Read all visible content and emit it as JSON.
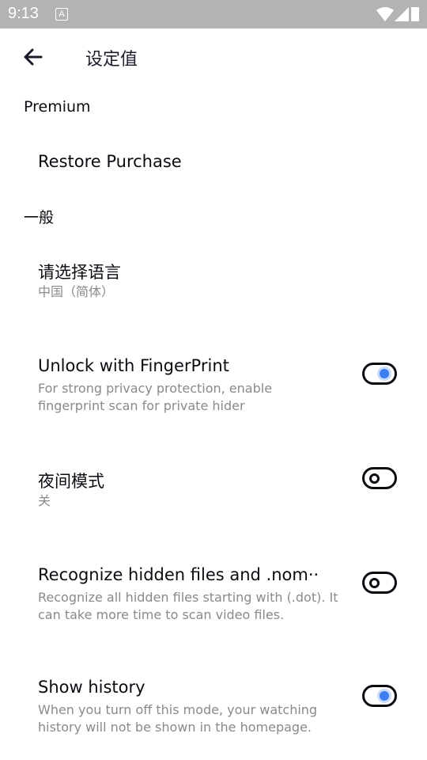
{
  "status_bar": {
    "time": "9:13",
    "notification_label": "A"
  },
  "toolbar": {
    "title": "设定值"
  },
  "sections": {
    "premium": {
      "header": "Premium",
      "restore_label": "Restore Purchase"
    },
    "general": {
      "header": "一般"
    }
  },
  "items": {
    "language": {
      "title": "请选择语言",
      "subtitle": "中国（简体）"
    },
    "fingerprint": {
      "title": "Unlock with FingerPrint",
      "subtitle": "For strong privacy protection, enable fingerprint scan for private hider",
      "enabled": true
    },
    "night_mode": {
      "title": "夜间模式",
      "subtitle": "关",
      "enabled": false
    },
    "hidden_files": {
      "title": "Recognize hidden files and .nom··",
      "subtitle": "Recognize all hidden files starting with (.dot). It can take more time to scan video files.",
      "enabled": false
    },
    "history": {
      "title": "Show history",
      "subtitle": "When you turn off this mode, your watching history will not be shown in the homepage.",
      "enabled": true
    }
  },
  "colors": {
    "accent": "#3f7ef0",
    "status_bar": "#b3b3b3",
    "subtitle": "#8a8a8a"
  },
  "icons": {
    "back": "arrow-left-icon",
    "wifi": "wifi-icon",
    "signal": "signal-icon",
    "battery": "battery-icon"
  }
}
